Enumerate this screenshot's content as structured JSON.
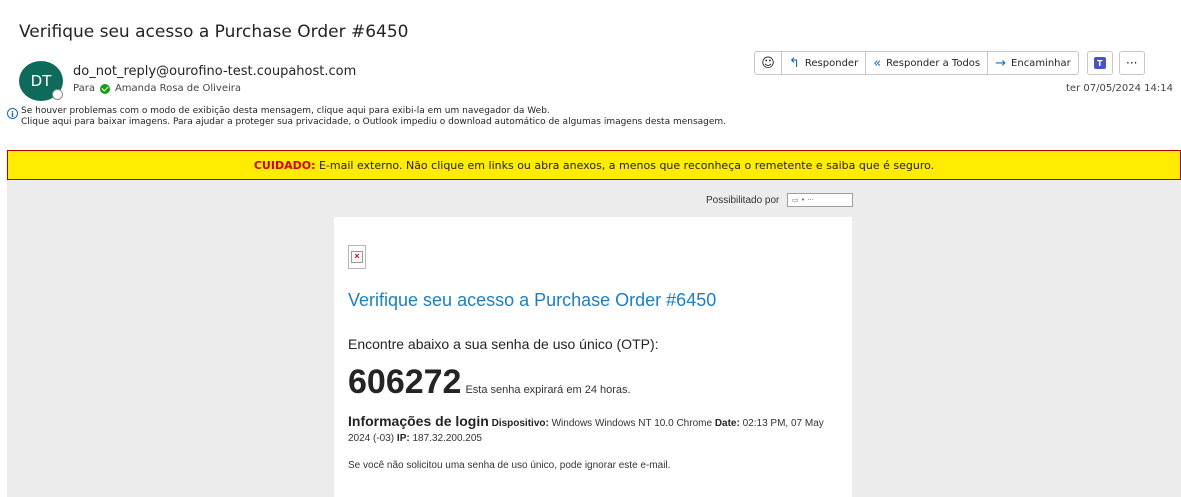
{
  "email": {
    "subject": "Verifique seu acesso a Purchase Order #6450",
    "avatar_initials": "DT",
    "sender": "do_not_reply@ourofino-test.coupahost.com",
    "to_label": "Para",
    "recipient": "Amanda Rosa de Oliveira",
    "date": "ter 07/05/2024 14:14",
    "info_line_1": "Se houver problemas com o modo de exibição desta mensagem, clique aqui para exibi-la em um navegador da Web.",
    "info_line_2": "Clique aqui para baixar imagens. Para ajudar a proteger sua privacidade, o Outlook impediu o download automático de algumas imagens desta mensagem."
  },
  "toolbar": {
    "reply_label": "Responder",
    "reply_all_label": "Responder a Todos",
    "forward_label": "Encaminhar"
  },
  "caution": {
    "label": "CUIDADO:",
    "text": " E-mail externo. Não clique em links ou abra anexos, a menos que reconheça o remetente e saiba que é seguro."
  },
  "body": {
    "powered_by": "Possibilitado por",
    "title": "Verifique seu acesso a Purchase Order #6450",
    "intro": "Encontre abaixo a sua senha de uso único (OTP):",
    "otp_code": "606272",
    "otp_note": "Esta senha expirará em 24 horas.",
    "login_heading": "Informações de login",
    "device_label": "Dispositivo:",
    "device_value": " Windows Windows NT 10.0 Chrome ",
    "date_label": "Date:",
    "date_value": " 02:13 PM, 07 May 2024 (-03) ",
    "ip_label": "IP:",
    "ip_value": " 187.32.200.205",
    "ignore_note": "Se você não solicitou uma senha de uso único, pode ignorar este e-mail."
  },
  "colors": {
    "avatar": "#0e6b5c",
    "caution_bg": "#ffec00",
    "caution_label": "#d40000",
    "title_link": "#1a7fc4"
  }
}
